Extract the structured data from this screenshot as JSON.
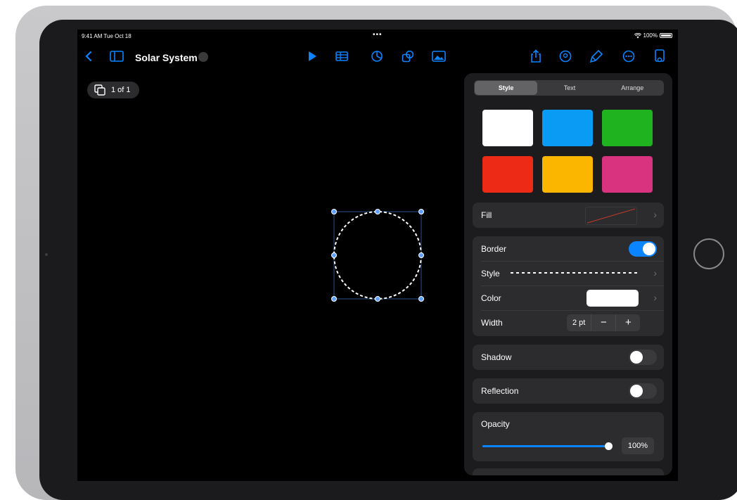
{
  "status": {
    "time": "9:41 AM  Tue Oct 18",
    "dots": "•••",
    "battery": "100%"
  },
  "toolbar": {
    "title": "Solar System",
    "icons": [
      "back-icon",
      "sidebar-icon",
      "play-icon",
      "table-icon",
      "chart-icon",
      "shapes-icon",
      "media-icon",
      "share-icon",
      "collaborate-icon",
      "format-brush-icon",
      "more-icon",
      "document-icon"
    ]
  },
  "page_counter": "1 of 1",
  "panel": {
    "tabs": [
      "Style",
      "Text",
      "Arrange"
    ],
    "active_tab": "Style",
    "swatches": [
      "#ffffff",
      "#0a9bf5",
      "#1fb41f",
      "#ec2a16",
      "#fbb700",
      "#d9327e"
    ],
    "fill": {
      "label": "Fill"
    },
    "border": {
      "label": "Border",
      "enabled": true,
      "style_label": "Style",
      "color_label": "Color",
      "color": "#ffffff",
      "width_label": "Width",
      "width_value": "2 pt",
      "minus": "−",
      "plus": "+"
    },
    "shadow": {
      "label": "Shadow",
      "enabled": false
    },
    "reflection": {
      "label": "Reflection",
      "enabled": false
    },
    "opacity": {
      "label": "Opacity",
      "value": 1.0,
      "value_label": "100%"
    }
  },
  "colors": {
    "accent": "#0a84ff",
    "toggle_off": "#3a3a3c"
  }
}
